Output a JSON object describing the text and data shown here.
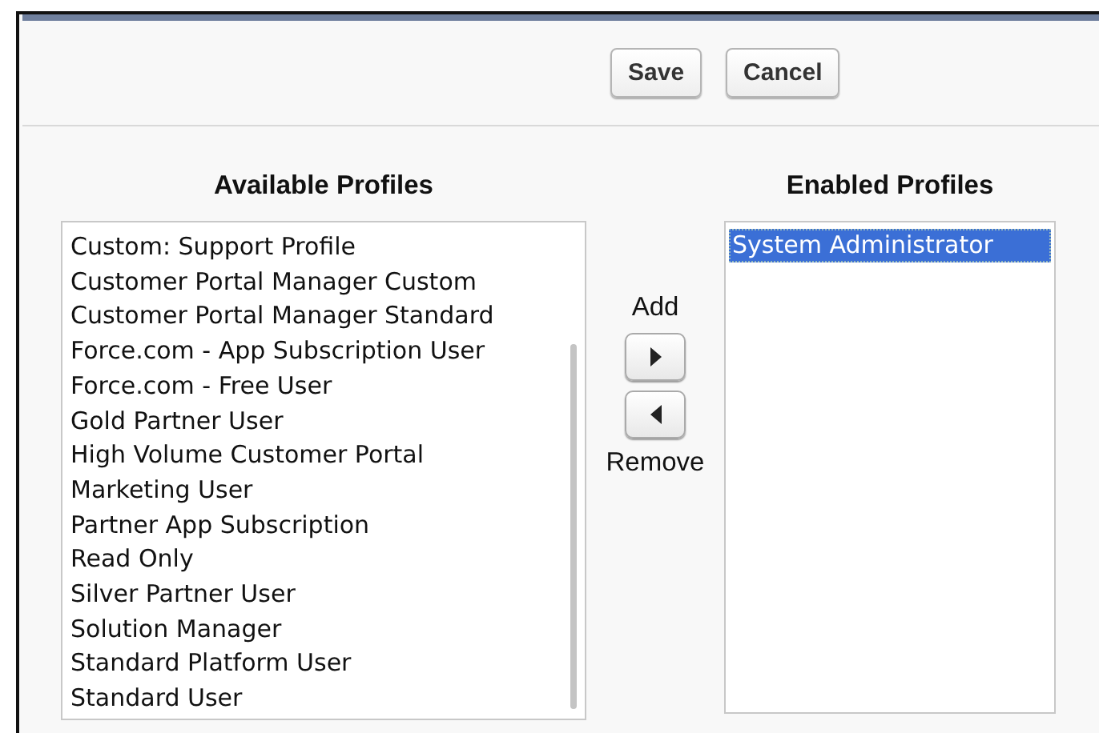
{
  "buttons": [
    {
      "label": "Save"
    },
    {
      "label": "Cancel"
    }
  ],
  "available": {
    "heading": "Available Profiles",
    "items": [
      {
        "label": "Custom: Support Profile",
        "selected": false
      },
      {
        "label": "Customer Portal Manager Custom",
        "selected": false
      },
      {
        "label": "Customer Portal Manager Standard",
        "selected": false
      },
      {
        "label": "Force.com - App Subscription User",
        "selected": false
      },
      {
        "label": "Force.com - Free User",
        "selected": false
      },
      {
        "label": "Gold Partner User",
        "selected": false
      },
      {
        "label": "High Volume Customer Portal",
        "selected": false
      },
      {
        "label": "Marketing User",
        "selected": false
      },
      {
        "label": "Partner App Subscription",
        "selected": false
      },
      {
        "label": "Read Only",
        "selected": false
      },
      {
        "label": "Silver Partner User",
        "selected": false
      },
      {
        "label": "Solution Manager",
        "selected": false
      },
      {
        "label": "Standard Platform User",
        "selected": false
      },
      {
        "label": "Standard User",
        "selected": false
      }
    ]
  },
  "add_label": "Add",
  "remove_label": "Remove",
  "enabled": {
    "heading": "Enabled Profiles",
    "items": [
      {
        "label": "System Administrator",
        "selected": true
      }
    ]
  }
}
